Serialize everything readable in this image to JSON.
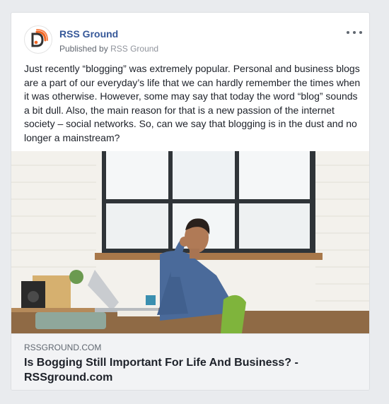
{
  "post": {
    "page_name": "RSS Ground",
    "published_prefix": "Published by",
    "published_page": "RSS Ground",
    "body": "Just recently “blogging” was extremely popular. Personal and business blogs are a part of our everyday’s life that we can hardly remember the times when it was otherwise. However, some may say that today the word “blog” sounds a bit dull. Also, the main reason for that is a new passion of the internet society – social networks. So, can we say that blogging is in the dust and no longer a mainstream?",
    "icons": {
      "avatar": "rss-ground-logo-icon",
      "more": "more-options-icon"
    },
    "link": {
      "domain": "RSSGROUND.COM",
      "title": "Is Bogging Still Important For Life And Business? - RSSground.com"
    }
  },
  "colors": {
    "page_bg": "#e9ebee",
    "name_link": "#365899",
    "brand_orange": "#f26522"
  }
}
